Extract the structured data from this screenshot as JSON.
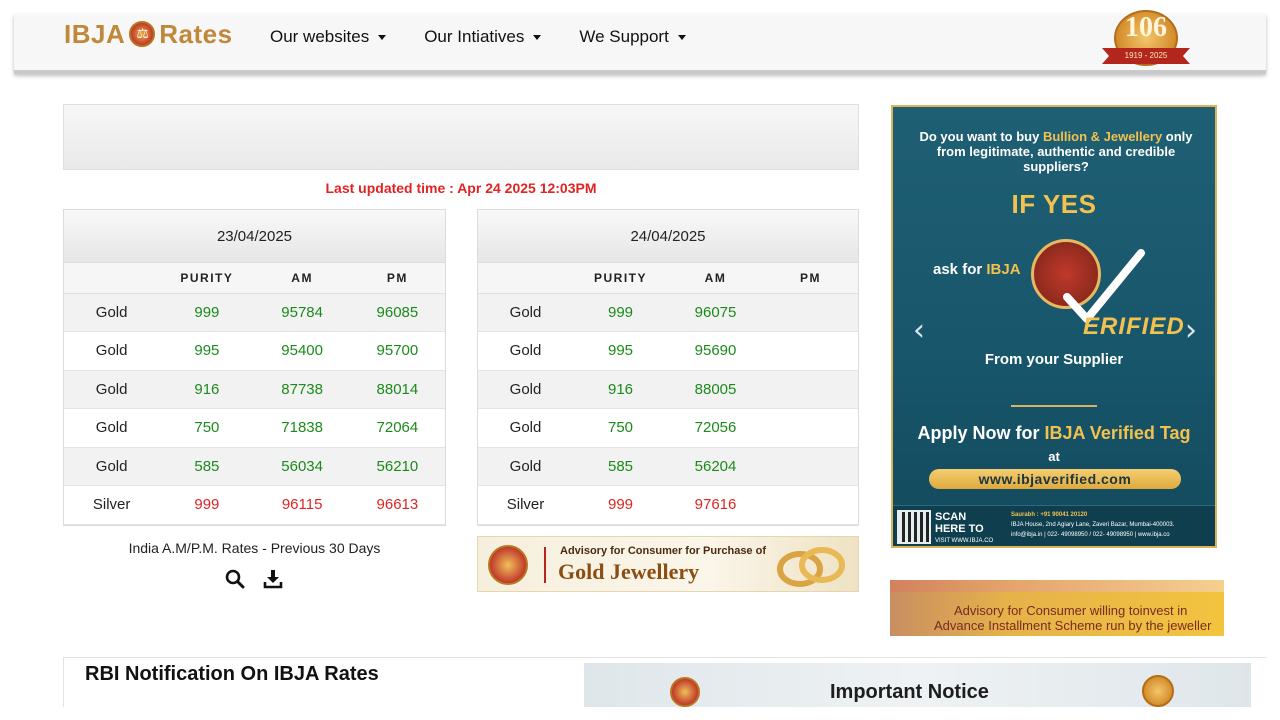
{
  "header": {
    "logo_left": "IBJA",
    "logo_right": "Rates",
    "nav": [
      {
        "label": "Our websites"
      },
      {
        "label": "Our Intiatives"
      },
      {
        "label": "We Support"
      }
    ],
    "badge_number": "106",
    "badge_ribbon": "1919 - 2025"
  },
  "last_updated": "Last updated time : Apr 24 2025 12:03PM",
  "tables": [
    {
      "date": "23/04/2025",
      "columns": [
        "",
        "PURITY",
        "AM",
        "PM"
      ],
      "rows": [
        {
          "metal": "Gold",
          "purity": "999",
          "am": "95784",
          "pm": "96085"
        },
        {
          "metal": "Gold",
          "purity": "995",
          "am": "95400",
          "pm": "95700"
        },
        {
          "metal": "Gold",
          "purity": "916",
          "am": "87738",
          "pm": "88014"
        },
        {
          "metal": "Gold",
          "purity": "750",
          "am": "71838",
          "pm": "72064"
        },
        {
          "metal": "Gold",
          "purity": "585",
          "am": "56034",
          "pm": "56210"
        },
        {
          "metal": "Silver",
          "purity": "999",
          "am": "96115",
          "pm": "96613"
        }
      ]
    },
    {
      "date": "24/04/2025",
      "columns": [
        "",
        "PURITY",
        "AM",
        "PM"
      ],
      "rows": [
        {
          "metal": "Gold",
          "purity": "999",
          "am": "96075",
          "pm": ""
        },
        {
          "metal": "Gold",
          "purity": "995",
          "am": "95690",
          "pm": ""
        },
        {
          "metal": "Gold",
          "purity": "916",
          "am": "88005",
          "pm": ""
        },
        {
          "metal": "Gold",
          "purity": "750",
          "am": "72056",
          "pm": ""
        },
        {
          "metal": "Gold",
          "purity": "585",
          "am": "56204",
          "pm": ""
        },
        {
          "metal": "Silver",
          "purity": "999",
          "am": "97616",
          "pm": ""
        }
      ]
    }
  ],
  "previous_rates": {
    "label": "India A.M/P.M. Rates - Previous 30 Days",
    "icons": [
      "search-icon",
      "download-icon"
    ]
  },
  "gold_banner": {
    "line1": "Advisory for Consumer for Purchase of",
    "line2": "Gold Jewellery"
  },
  "ad": {
    "question_a": "Do you want to buy ",
    "question_hl": "Bullion & Jewellery",
    "question_b": " only from legitimate, authentic and credible suppliers?",
    "if_yes": "IF YES",
    "ask_for": "ask for ",
    "ask_hl": "IBJA",
    "verified": "ERIFIED",
    "from_supplier": "From your Supplier",
    "apply_a": "Apply Now for ",
    "apply_hl": "IBJA Verified Tag",
    "at": "at",
    "url": "www.ibjaverified.com",
    "scan_line1": "SCAN",
    "scan_line2": "HERE TO",
    "scan_small": "VISIT WWW.IBJA.CO",
    "contact_name": "Saurabh : +91 90041 20120",
    "contact_address": "IBJA House, 2nd Agiary Lane, Zaveri Bazar, Mumbai-400003.",
    "contact_email": "info@ibja.in  |  022- 49098950 / 022- 49098950  |  www.ibja.co"
  },
  "advisory_banner": {
    "line1": "Advisory for Consumer willing toinvest in",
    "line2": "Advance Installment Scheme run by the jeweller"
  },
  "bottom": {
    "rbi_title": "RBI Notification On IBJA Rates",
    "notice_title": "Important Notice"
  },
  "colors": {
    "green_value": "#1b8a1b",
    "red_value": "#e02424",
    "brand_gold": "#c0883a",
    "ad_teal": "#1f5f74"
  }
}
